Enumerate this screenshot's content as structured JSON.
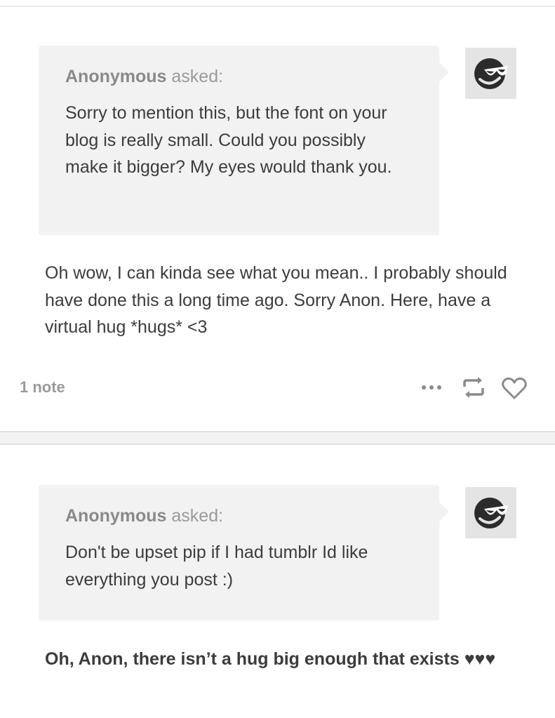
{
  "post1": {
    "asker_name": "Anonymous",
    "asker_verb": " asked:",
    "question": "Sorry to mention this, but the font on your blog is really small. Could you possibly make it bigger? My eyes would thank you.",
    "answer": "Oh wow, I can kinda see what you mean.. I probably should have done this a long time ago. Sorry Anon. Here, have a virtual hug *hugs* <3",
    "notes": "1 note",
    "actions": [
      "more-icon",
      "reblog-icon",
      "heart-icon"
    ]
  },
  "post2": {
    "asker_name": "Anonymous",
    "asker_verb": " asked:",
    "question": "Don't be upset pip if I had tumblr Id like everything you post :)",
    "answer": "Oh, Anon, there isn’t a hug big enough that exists ♥♥♥"
  },
  "colors": {
    "bubble": "#f2f2f2",
    "text": "#3c3c3c",
    "muted": "#9a9a9a",
    "avatar_bg": "#e4e4e4"
  }
}
